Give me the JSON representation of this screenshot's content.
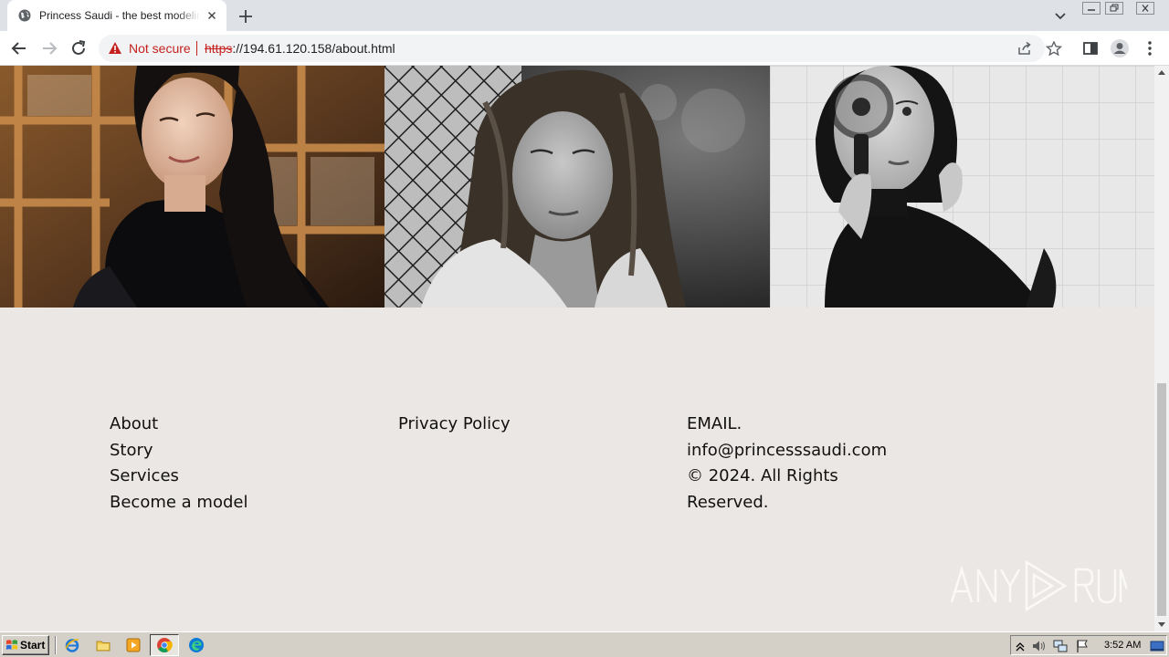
{
  "browser": {
    "tab_title": "Princess Saudi - the best modeling agency",
    "security_label": "Not secure",
    "url_scheme": "https",
    "url_rest": "://194.61.120.158/about.html"
  },
  "footer": {
    "links": [
      "About",
      "Story",
      "Services",
      "Become a model"
    ],
    "policy": "Privacy Policy",
    "email_label": "EMAIL.",
    "email": "info@princesssaudi.com",
    "copyright_line1": "© 2024. All Rights",
    "copyright_line2": "Reserved."
  },
  "gallery": {
    "photos": [
      "woman-smiling-eyes-closed-photo",
      "woman-freckles-fence-photo",
      "woman-magnifying-glass-photo"
    ]
  },
  "watermark": "ANY RUN",
  "taskbar": {
    "start_label": "Start",
    "clock": "3:52 AM"
  },
  "colors": {
    "footer_bg": "#ebe7e4",
    "warning_red": "#c5221f"
  }
}
